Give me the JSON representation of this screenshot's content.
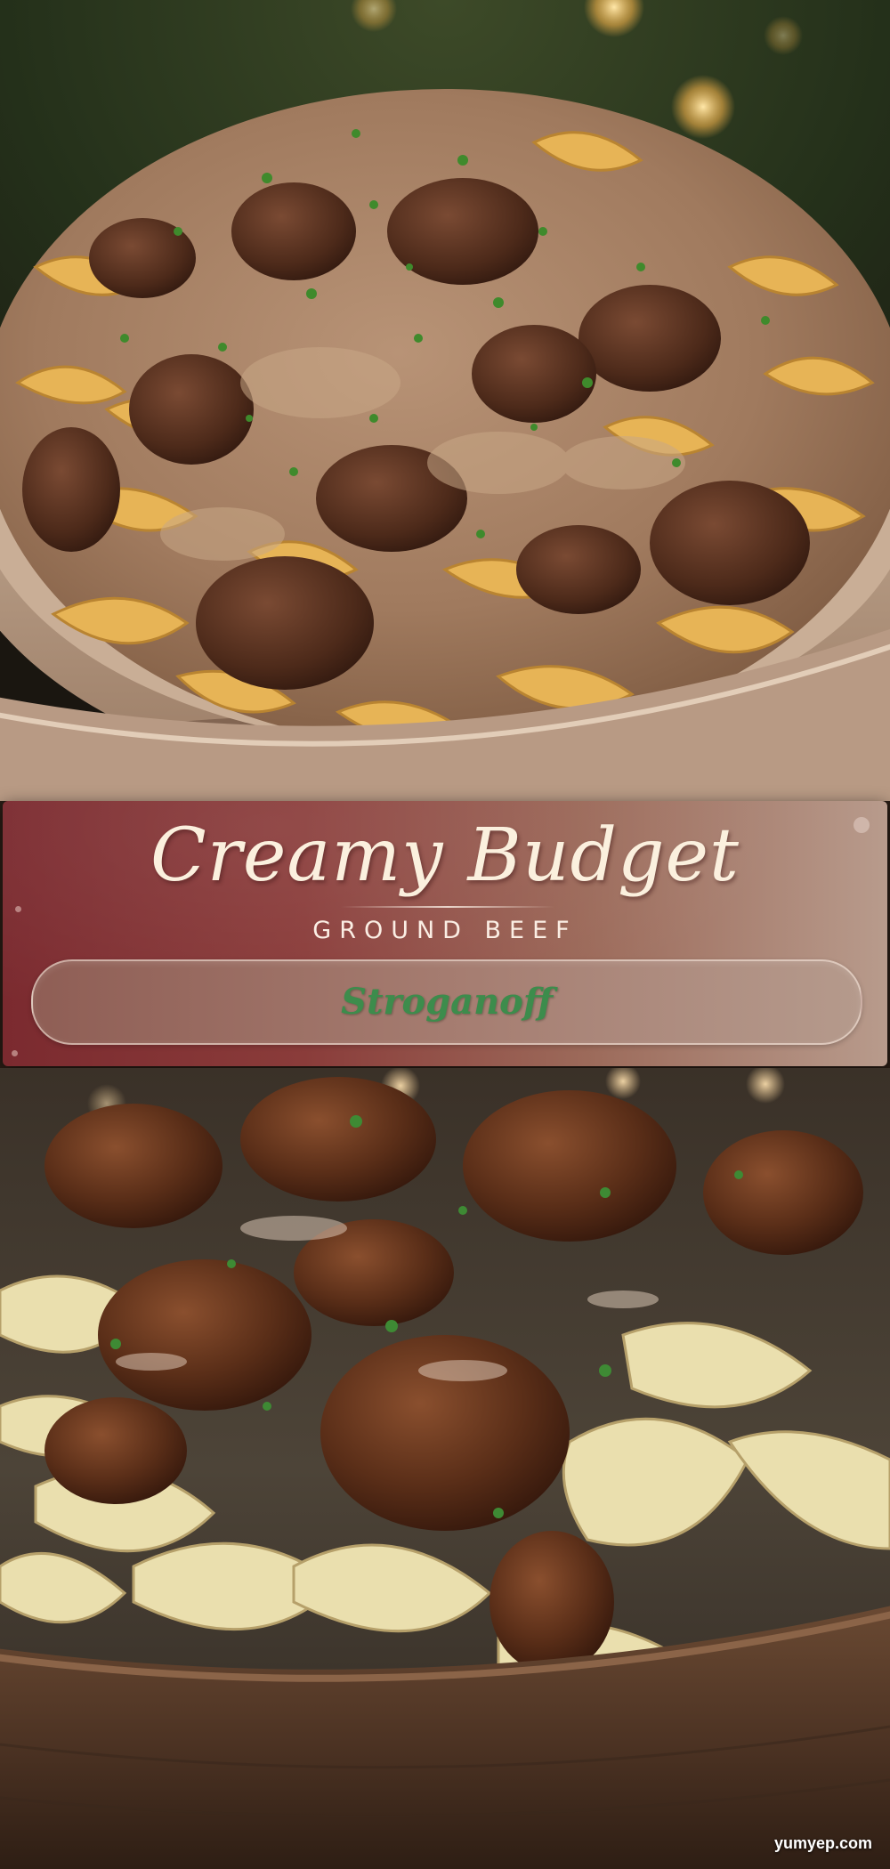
{
  "title": {
    "line1": "Creamy Budget",
    "line2": "GROUND BEEF",
    "line3": "Stroganoff"
  },
  "watermark": "yumyep.com",
  "colors": {
    "panel_left": "#7b2a2f",
    "panel_right": "#b89b8c",
    "title_text": "#fbf0de",
    "accent_green": "#3d8c4c"
  },
  "images": {
    "top": "creamy beef stroganoff with egg noodles and parsley in a speckled ceramic bowl",
    "bottom": "ground beef stroganoff with wide egg noodles in a rustic wooden bowl"
  }
}
